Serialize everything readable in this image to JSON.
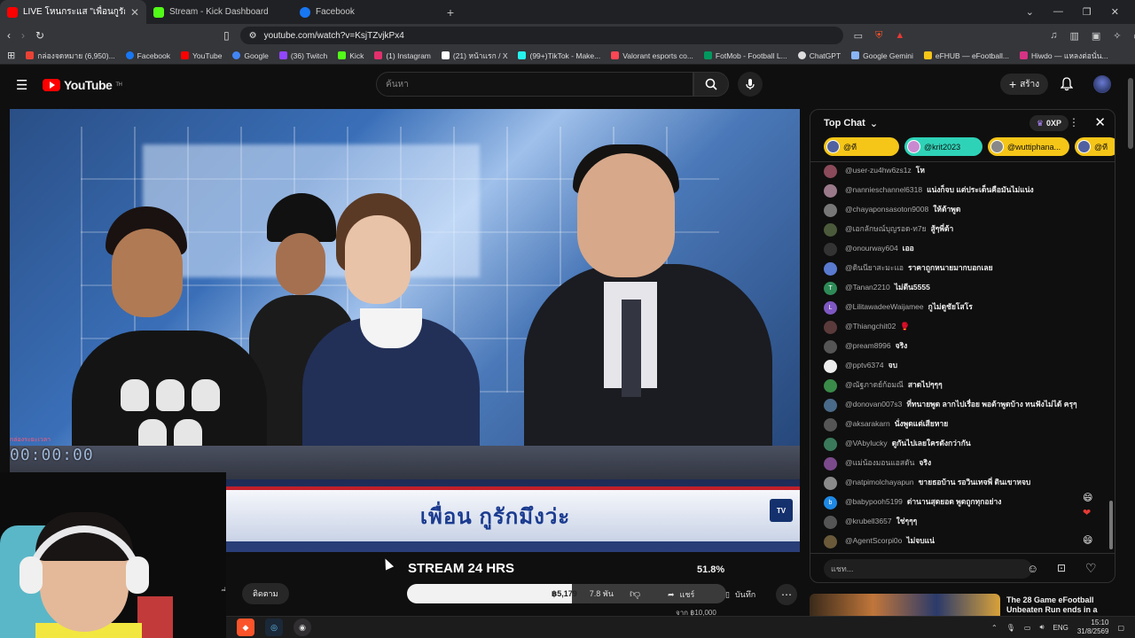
{
  "browser": {
    "tabs": [
      {
        "title": "LIVE โหนกระแส \"เพื่อนกูรักมึงว่ะ\"",
        "color": "#ff0000",
        "active": true
      },
      {
        "title": "Stream - Kick Dashboard",
        "color": "#53fc18",
        "active": false
      },
      {
        "title": "Facebook",
        "color": "#1877f2",
        "active": false
      }
    ],
    "url": "youtube.com/watch?v=KsjTZvjkPx4",
    "bookmarks": [
      {
        "label": "กล่องจดหมาย (6,950)...",
        "color": "#ea4335"
      },
      {
        "label": "Facebook",
        "color": "#1877f2"
      },
      {
        "label": "YouTube",
        "color": "#ff0000"
      },
      {
        "label": "Google",
        "color": "#4285f4"
      },
      {
        "label": "(36) Twitch",
        "color": "#9146ff"
      },
      {
        "label": "Kick",
        "color": "#53fc18"
      },
      {
        "label": "(1) Instagram",
        "color": "#e1306c"
      },
      {
        "label": "(21) หน้าแรก / X",
        "color": "#ffffff"
      },
      {
        "label": "(99+)TikTok - Make...",
        "color": "#25f4ee"
      },
      {
        "label": "Valorant esports co...",
        "color": "#ff4655"
      },
      {
        "label": "FotMob - Football L...",
        "color": "#00985f"
      },
      {
        "label": "ChatGPT",
        "color": "#dddddd"
      },
      {
        "label": "Google Gemini",
        "color": "#8ab4f8"
      },
      {
        "label": "eFHUB — eFootball...",
        "color": "#f5c518"
      },
      {
        "label": "Hiwdo — แหลงต่อนั่น...",
        "color": "#d63384"
      }
    ]
  },
  "youtube": {
    "logo": "YouTube",
    "logo_sup": "TH",
    "search_placeholder": "ค้นหา",
    "create_label": "สร้าง"
  },
  "video": {
    "lower_third": "เพื่อน กูรักมึงว่ะ",
    "timer": "00:00:00",
    "timer_label": "กล่องระยะเวลา"
  },
  "below": {
    "stream_title": "STREAM 24 HRS",
    "percent": "51.8%",
    "subscribe": "ติดตาม",
    "likes": "฿5,179",
    "likes_count": "7.8 พัน",
    "share": "แชร์",
    "save": "บันทึก",
    "goal": "จาก ฿10,000",
    "progress_fraction": 0.518
  },
  "chat": {
    "header": "Top Chat",
    "xp": "0XP",
    "pills": [
      {
        "name": "@ที",
        "color": "#f5c518"
      },
      {
        "name": "@krit2023",
        "color": "#2ed3b7"
      },
      {
        "name": "@wuttiphana...",
        "color": "#f5c518"
      },
      {
        "name": "@ที",
        "color": "#f5c518"
      }
    ],
    "messages": [
      {
        "author": "@user-zu4hw6zs1z",
        "text": "โห",
        "color": "#8a4a5a"
      },
      {
        "author": "@nannieschannel6318",
        "text": "แน่งก็จบ แต่ประเด็นคือมันไม่แน่ง",
        "color": "#9a7a8a"
      },
      {
        "author": "@chayaponsasoton9008",
        "text": "ให้ต้าพูด",
        "color": "#777777"
      },
      {
        "author": "@เอกลักษณ์บุญรอด-ท7ย",
        "text": "สู้ๆพี่ต้า",
        "color": "#4a5a3a"
      },
      {
        "author": "@onourway604",
        "text": "เออ",
        "color": "#333333"
      },
      {
        "author": "@ดินนียาสะมะแอ",
        "text": "ราคาถูกหนายมากบอกเลย",
        "color": "#5a7ad0"
      },
      {
        "author": "@Tanan2210",
        "text": "ไม่ดีน5555",
        "color": "#2e8b57",
        "initial": "T"
      },
      {
        "author": "@LilitawadeeWaijamee",
        "text": "กูไม่ดูชัยโสโร",
        "color": "#7e57c2",
        "initial": "L"
      },
      {
        "author": "@Thiangchit02",
        "text": "🥊",
        "color": "#5a3a3a"
      },
      {
        "author": "@pream8996",
        "text": "จริง",
        "color": "#555555"
      },
      {
        "author": "@pptv6374",
        "text": "จบ",
        "color": "#eeeeee"
      },
      {
        "author": "@ณัฐภาดย์ก้อมณี",
        "text": "สาดไปๆๆๆ",
        "color": "#3a8a4a"
      },
      {
        "author": "@donovan007s3",
        "text": "ที่ทนายพูด ลากไปเรื่อย พอต้าพูดบ้าง ทนฟังไม่ได้ ครุๆ",
        "color": "#4a6a8a"
      },
      {
        "author": "@aksarakarn",
        "text": "นั่งพูดแต่เสียหาย",
        "color": "#555555"
      },
      {
        "author": "@VAbylucky",
        "text": "ดูกันไปเลยใครดังกว่ากัน",
        "color": "#3a7a5a"
      },
      {
        "author": "@แม่น้องมอนแอสดัน",
        "text": "จริง",
        "color": "#7a4a8a"
      },
      {
        "author": "@natpimolchayapun",
        "text": "ขายธอบ้าน รอวินเทจพี่ ดินเขาหจบ",
        "color": "#8a8a8a"
      },
      {
        "author": "@babypooh5199",
        "text": "ด่านานสุดยอด พูดถูกทุกอย่าง",
        "color": "#1e88e5",
        "initial": "b"
      },
      {
        "author": "@krubell3657",
        "text": "ใช่ๆๆๆ",
        "color": "#555555"
      },
      {
        "author": "@AgentScorpi0o",
        "text": "ไม่จบแน่",
        "color": "#6a5a3a"
      }
    ],
    "input_placeholder": "แชท..."
  },
  "recommendation": {
    "title": "The 28 Game eFootball Unbeaten Run ends in a"
  },
  "taskbar": {
    "lang": "ENG",
    "time": "15:10",
    "date": "31/8/2569"
  }
}
